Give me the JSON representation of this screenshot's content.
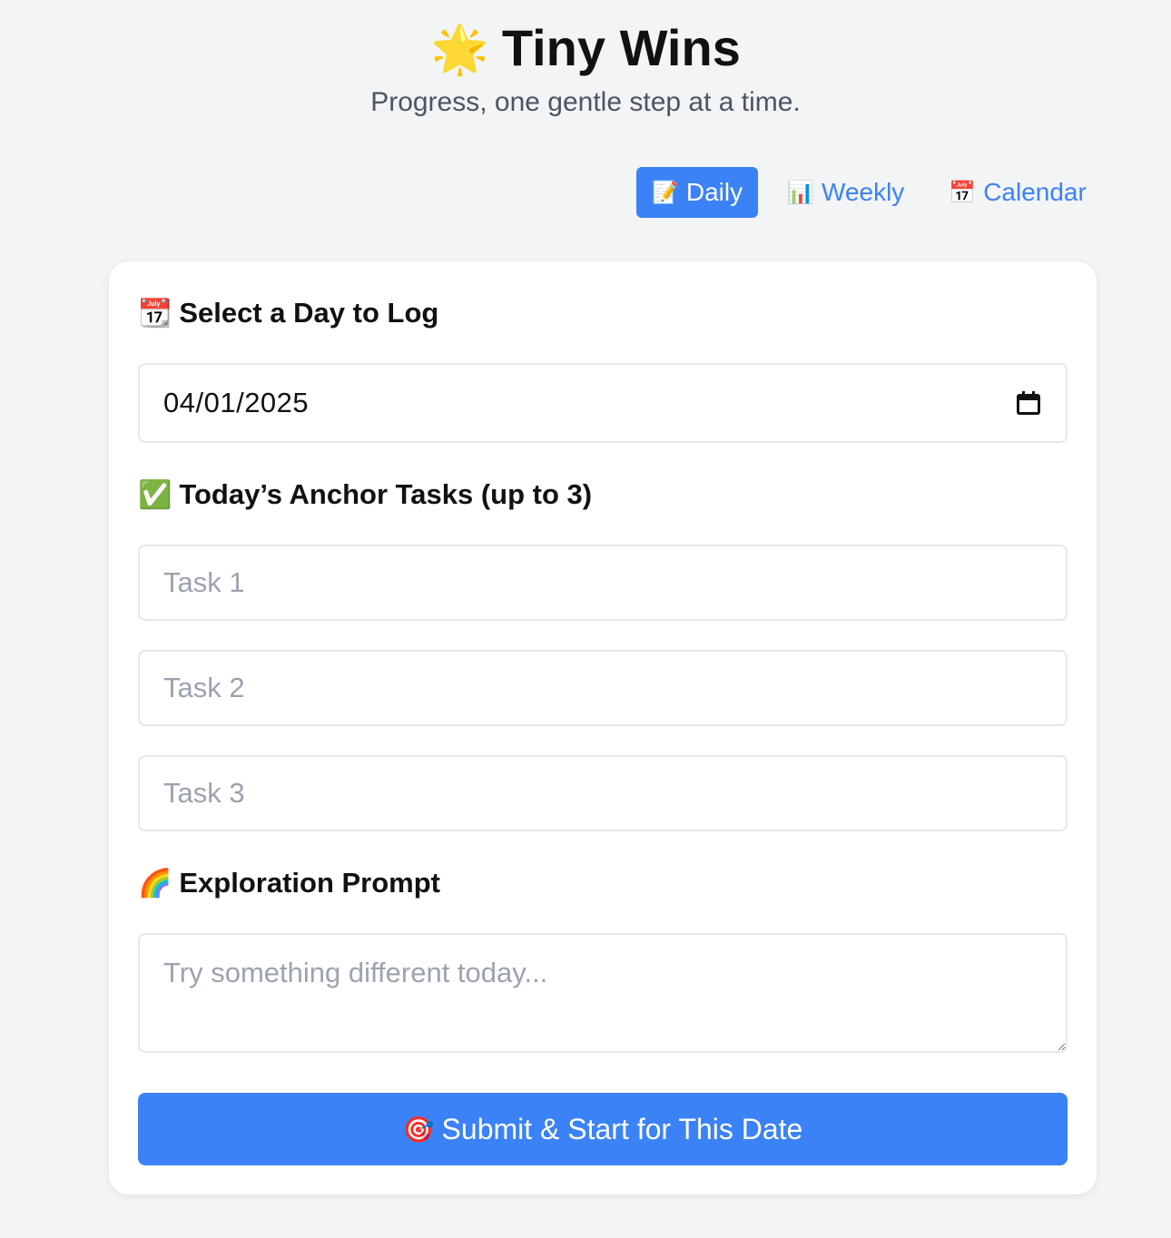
{
  "header": {
    "title_emoji": "🌟",
    "title": "Tiny Wins",
    "tagline": "Progress, one gentle step at a time."
  },
  "tabs": [
    {
      "emoji": "📝",
      "label": "Daily",
      "active": true
    },
    {
      "emoji": "📊",
      "label": "Weekly",
      "active": false
    },
    {
      "emoji": "📅",
      "label": "Calendar",
      "active": false
    }
  ],
  "form": {
    "date_section": {
      "emoji": "📆",
      "heading": "Select a Day to Log"
    },
    "date_value": "04/01/2025",
    "tasks_section": {
      "emoji": "✅",
      "heading": "Today’s Anchor Tasks (up to 3)"
    },
    "tasks": [
      {
        "placeholder": "Task 1",
        "value": ""
      },
      {
        "placeholder": "Task 2",
        "value": ""
      },
      {
        "placeholder": "Task 3",
        "value": ""
      }
    ],
    "exploration_section": {
      "emoji": "🌈",
      "heading": "Exploration Prompt"
    },
    "exploration_placeholder": "Try something different today...",
    "submit": {
      "emoji": "🎯",
      "label": "Submit & Start for This Date"
    }
  },
  "colors": {
    "accent": "#3b82f6",
    "background": "#f3f4f6",
    "card": "#ffffff",
    "muted_text": "#4b5563",
    "placeholder": "#9ca3af",
    "border": "#e5e7eb"
  }
}
